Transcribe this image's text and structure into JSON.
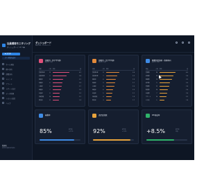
{
  "app": {
    "title_line1": "社員環境モニタリング",
    "title_line2": "ダッシュボード",
    "subtitle": "v2.1 ●"
  },
  "sidebar": {
    "primary_button": "▶ 実行中",
    "secondary_button": "データ読み込み",
    "items": [
      {
        "label": "ホーム画面",
        "icon": "home-icon"
      },
      {
        "label": "個人分析",
        "icon": "user-icon"
      },
      {
        "label": "部署分析",
        "icon": "building-icon"
      },
      {
        "label": "トレンド",
        "icon": "trend-icon"
      },
      {
        "label": "アラート",
        "icon": "alert-icon"
      },
      {
        "label": "レポート出力",
        "icon": "report-icon"
      },
      {
        "label": "データ管理",
        "icon": "database-icon"
      },
      {
        "label": "システム設定",
        "icon": "gear-icon"
      },
      {
        "label": "ヘルプ",
        "icon": "help-icon"
      }
    ],
    "footer_name": "管理者",
    "footer_sub": "admin@example"
  },
  "header": {
    "title": "ダッシュボード",
    "subtitle": "最終更新: 2024/01/15"
  },
  "panels": [
    {
      "title": "部署別・男子平均値",
      "subtitle": "過去6ヶ月間",
      "accent": "#e0507a",
      "bar_color": "#e0507a",
      "columns": [
        "部署",
        "人数",
        "推移",
        "値"
      ],
      "rows": [
        {
          "name": "営業第1課",
          "count": "12",
          "pct": 0.72,
          "value": "4.2"
        },
        {
          "name": "営業第2課",
          "count": "9",
          "pct": 0.6,
          "value": "3.8"
        },
        {
          "name": "開発部",
          "count": "15",
          "pct": 0.45,
          "value": "3.1"
        },
        {
          "name": "総務部",
          "count": "6",
          "pct": 0.4,
          "value": "2.9"
        },
        {
          "name": "人事部",
          "count": "5",
          "pct": 0.38,
          "value": "2.7"
        },
        {
          "name": "経理部",
          "count": "7",
          "pct": 0.34,
          "value": "2.5"
        },
        {
          "name": "企画部",
          "count": "8",
          "pct": 0.3,
          "value": "2.3"
        },
        {
          "name": "品質管理",
          "count": "10",
          "pct": 0.28,
          "value": "2.1"
        },
        {
          "name": "物流部",
          "count": "11",
          "pct": 0.25,
          "value": "1.9"
        }
      ]
    },
    {
      "title": "部署別・女子平均値",
      "subtitle": "過去6ヶ月間",
      "accent": "#e38a3a",
      "bar_color": "#e38a3a",
      "columns": [
        "部署",
        "人数",
        "推移",
        "値"
      ],
      "rows": [
        {
          "name": "営業第1課",
          "count": "8",
          "pct": 0.55,
          "value": "3.6"
        },
        {
          "name": "営業第2課",
          "count": "7",
          "pct": 0.48,
          "value": "3.2"
        },
        {
          "name": "開発部",
          "count": "6",
          "pct": 0.42,
          "value": "2.9"
        },
        {
          "name": "総務部",
          "count": "9",
          "pct": 0.38,
          "value": "2.7"
        },
        {
          "name": "人事部",
          "count": "8",
          "pct": 0.34,
          "value": "2.5"
        },
        {
          "name": "経理部",
          "count": "6",
          "pct": 0.3,
          "value": "2.3"
        },
        {
          "name": "企画部",
          "count": "5",
          "pct": 0.27,
          "value": "2.1"
        },
        {
          "name": "品質管理",
          "count": "4",
          "pct": 0.24,
          "value": "1.9"
        },
        {
          "name": "物流部",
          "count": "3",
          "pct": 0.2,
          "value": "1.7"
        }
      ]
    },
    {
      "title": "職種別環境値・推移傾向",
      "subtitle": "過去6ヶ月間",
      "accent": "#3f8ce6",
      "bar_color": "#e8a33c",
      "columns": [
        "職種",
        "人数",
        "推移",
        "値"
      ],
      "rows": [
        {
          "name": "営業職",
          "count": "24",
          "pct": 0.68,
          "value": "4.0"
        },
        {
          "name": "技術職",
          "count": "18",
          "pct": 0.6,
          "value": "3.6"
        },
        {
          "name": "事務職",
          "count": "15",
          "pct": 0.52,
          "value": "3.3"
        },
        {
          "name": "研究職",
          "count": "9",
          "pct": 0.44,
          "value": "3.0"
        },
        {
          "name": "管理職",
          "count": "12",
          "pct": 0.4,
          "value": "2.8"
        },
        {
          "name": "製造職",
          "count": "20",
          "pct": 0.36,
          "value": "2.6"
        },
        {
          "name": "企画職",
          "count": "7",
          "pct": 0.32,
          "value": "2.4"
        },
        {
          "name": "サポート",
          "count": "10",
          "pct": 0.28,
          "value": "2.2"
        },
        {
          "name": "その他",
          "count": "5",
          "pct": 0.22,
          "value": "1.8"
        }
      ]
    }
  ],
  "metrics": [
    {
      "title": "稼働率",
      "value": "85%",
      "sub1": "前月比",
      "sub2": "+2.1%",
      "accent": "#3f8ce6",
      "fill": 0.85
    },
    {
      "title": "満足度指数",
      "value": "92%",
      "sub1": "前月比",
      "sub2": "+1.4%",
      "accent": "#e8a33c",
      "fill": 0.92
    },
    {
      "title": "KPI達成率",
      "value": "+8.5%",
      "sub1": "前月比",
      "sub2": "改善",
      "accent": "#2fb36a",
      "fill": 0.68
    }
  ]
}
